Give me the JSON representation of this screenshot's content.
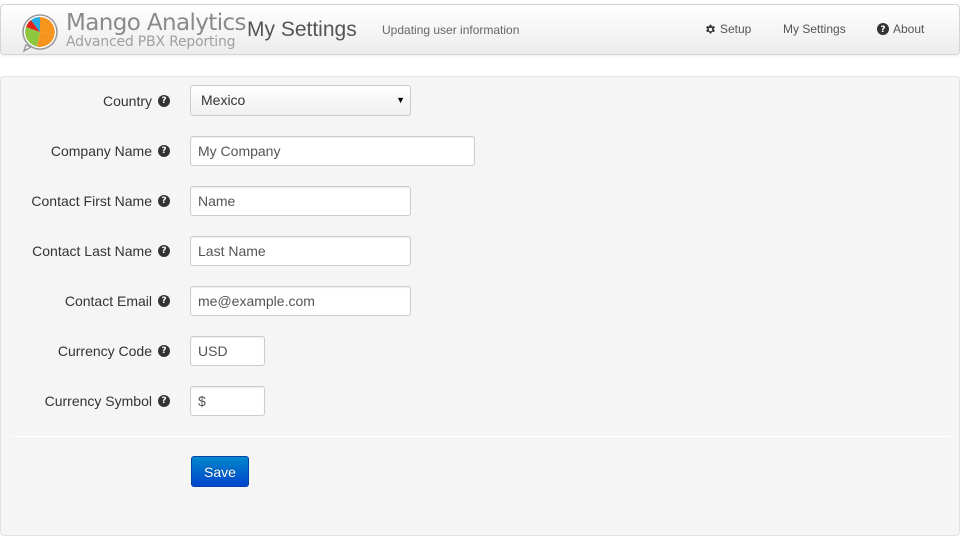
{
  "brand": {
    "title": "Mango Analytics",
    "subtitle": "Advanced PBX Reporting"
  },
  "header": {
    "title": "My Settings",
    "subtitle": "Updating user information"
  },
  "nav": {
    "setup": "Setup",
    "my_settings": "My Settings",
    "about": "About"
  },
  "form": {
    "country": {
      "label": "Country",
      "value": "Mexico"
    },
    "company_name": {
      "label": "Company Name",
      "value": "My Company"
    },
    "contact_first_name": {
      "label": "Contact First Name",
      "value": "Name"
    },
    "contact_last_name": {
      "label": "Contact Last Name",
      "value": "Last Name"
    },
    "contact_email": {
      "label": "Contact Email",
      "value": "me@example.com"
    },
    "currency_code": {
      "label": "Currency Code",
      "value": "USD"
    },
    "currency_symbol": {
      "label": "Currency Symbol",
      "value": "$"
    },
    "help_glyph": "?",
    "save_label": "Save"
  },
  "icons": {
    "logo": "mango-pie-logo",
    "setup": "gear-icon",
    "about": "question-circle-icon",
    "help": "question-circle-icon",
    "select_caret": "caret-down-icon"
  },
  "colors": {
    "primary_button": "#0066cc",
    "panel_background": "#f5f5f5",
    "logo_orange": "#f7941d",
    "logo_red": "#e2231a",
    "logo_green": "#8dc63f",
    "logo_blue": "#27aae1"
  }
}
